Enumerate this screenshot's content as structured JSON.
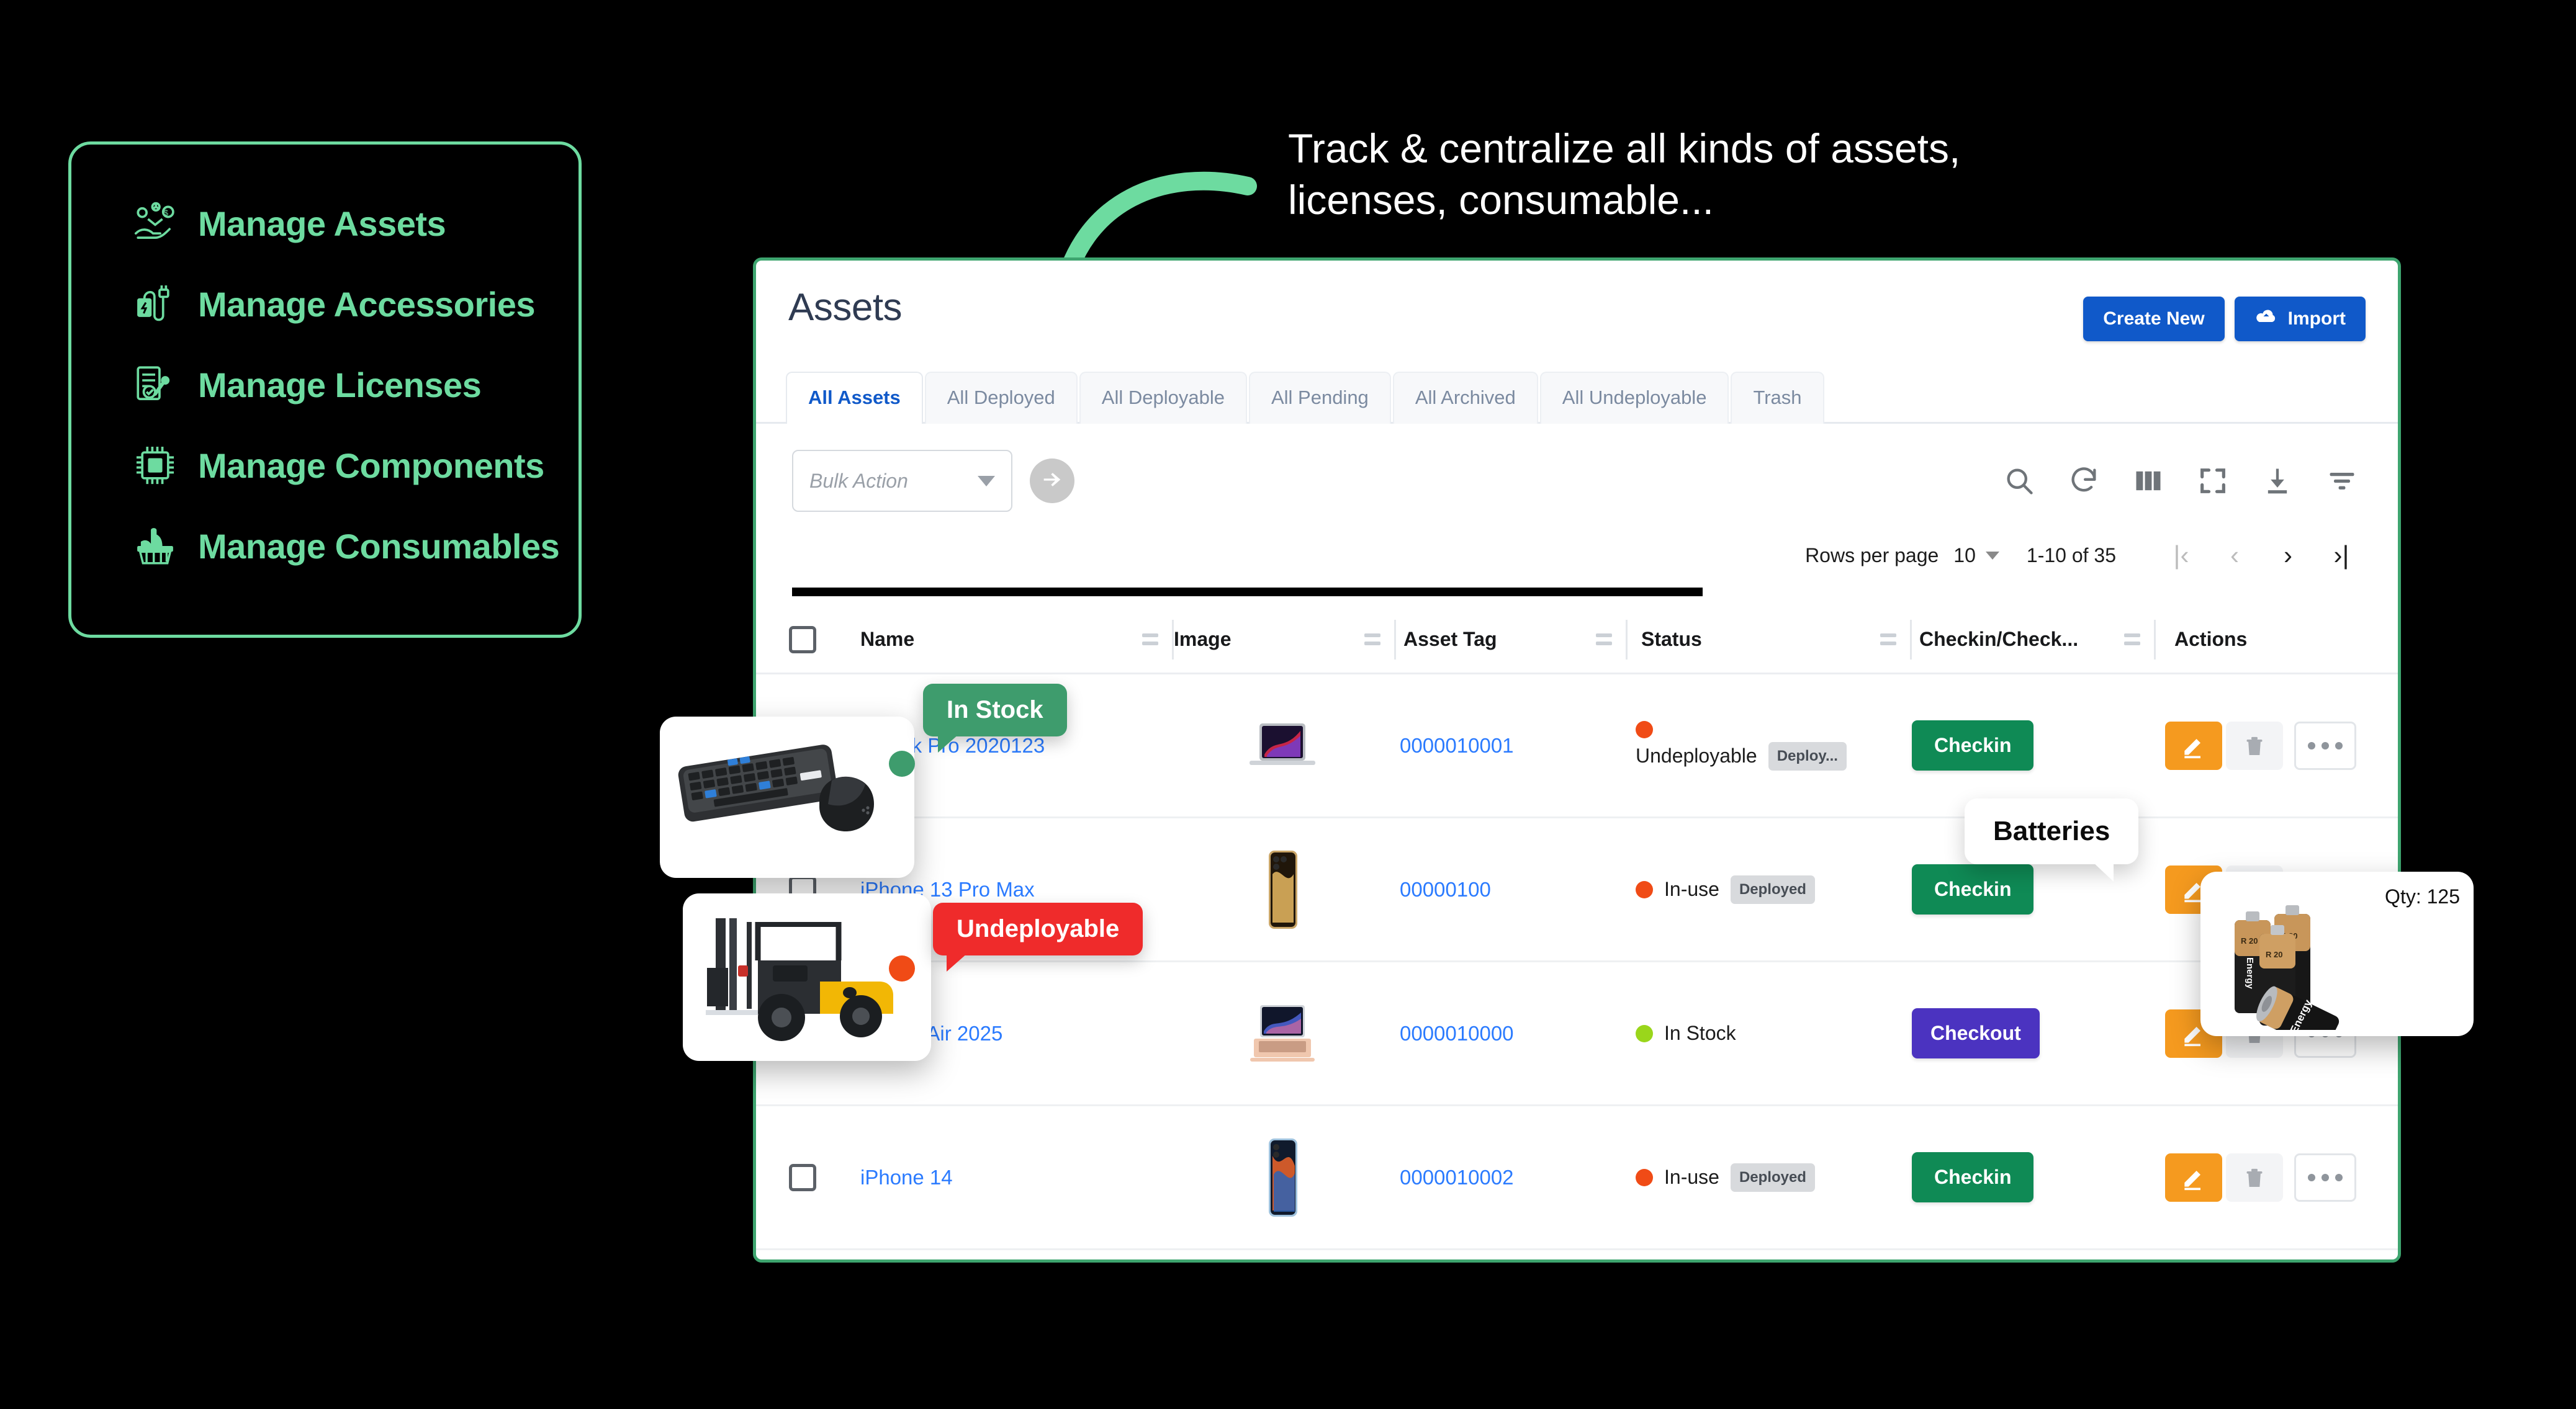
{
  "features": {
    "items": [
      {
        "label": "Manage Assets",
        "icon": "assets-hand-icon"
      },
      {
        "label": "Manage Accessories",
        "icon": "charger-cable-icon"
      },
      {
        "label": "Manage Licenses",
        "icon": "license-document-icon"
      },
      {
        "label": "Manage Components",
        "icon": "chip-icon"
      },
      {
        "label": "Manage Consumables",
        "icon": "basket-icon"
      }
    ],
    "accent_color": "#6ddba0"
  },
  "headline": {
    "line1": "Track & centralize all kinds of assets,",
    "line2": "licenses, consumable..."
  },
  "app": {
    "title": "Assets",
    "buttons": {
      "create_new": "Create New",
      "import": "Import",
      "import_icon": "cloud-upload-icon"
    },
    "tabs": [
      {
        "label": "All Assets",
        "active": true
      },
      {
        "label": "All Deployed",
        "active": false
      },
      {
        "label": "All Deployable",
        "active": false
      },
      {
        "label": "All Pending",
        "active": false
      },
      {
        "label": "All Archived",
        "active": false
      },
      {
        "label": "All Undeployable",
        "active": false
      },
      {
        "label": "Trash",
        "active": false
      }
    ],
    "toolbar": {
      "bulk_action_placeholder": "Bulk Action",
      "go_icon": "arrow-right-circle-icon",
      "icons": [
        "search-icon",
        "refresh-icon",
        "columns-icon",
        "fullscreen-icon",
        "download-icon",
        "filter-icon"
      ]
    },
    "pagination": {
      "rows_per_page_label": "Rows per page",
      "rows_per_page_value": "10",
      "range": "1-10 of 35",
      "first": "|‹",
      "prev": "‹",
      "next": "›",
      "last": "›|"
    },
    "table": {
      "columns": [
        "Name",
        "Image",
        "Asset Tag",
        "Status",
        "Checkin/Check...",
        "Actions"
      ],
      "rows": [
        {
          "name": "...book Pro 2020123",
          "image": "macbook-pro-thumbnail",
          "asset_tag": "0000010001",
          "status_text": "Undeployable",
          "status_color": "#f04b16",
          "status_chip": "Deploy...",
          "action_label": "Checkin",
          "action_style": "green",
          "has_more": true
        },
        {
          "name": "iPhone 13 Pro Max",
          "image": "iphone-gold-thumbnail",
          "asset_tag": "00000100",
          "status_text": "In-use",
          "status_color": "#f04b16",
          "status_chip": "Deployed",
          "action_label": "Checkin",
          "action_style": "green",
          "has_more": false
        },
        {
          "name": "...book Air 2025",
          "image": "macbook-air-thumbnail",
          "asset_tag": "0000010000",
          "status_text": "In Stock",
          "status_color": "#9ad61b",
          "status_chip": "",
          "action_label": "Checkout",
          "action_style": "purple",
          "has_more": false
        },
        {
          "name": "iPhone 14",
          "image": "iphone-14-blue-thumbnail",
          "asset_tag": "0000010002",
          "status_text": "In-use",
          "status_color": "#f04b16",
          "status_chip": "Deployed",
          "action_label": "Checkin",
          "action_style": "green",
          "has_more": true
        }
      ]
    }
  },
  "callouts": {
    "in_stock": "In Stock",
    "undeployable": "Undeployable",
    "batteries": "Batteries"
  },
  "cards": {
    "keyboard": "keyboard-mouse-photo",
    "forklift": "forklift-photo",
    "batteries": "batteries-photo",
    "qty_label": "Qty:",
    "qty_value": "125"
  },
  "colors": {
    "green_accent": "#6ddba0",
    "window_border": "#3ea56f",
    "blue_button": "#1059c9",
    "green_button": "#0f8a55",
    "purple_button": "#4b33c0",
    "orange_edit": "#f59a1f",
    "link_blue": "#2b7bff"
  }
}
